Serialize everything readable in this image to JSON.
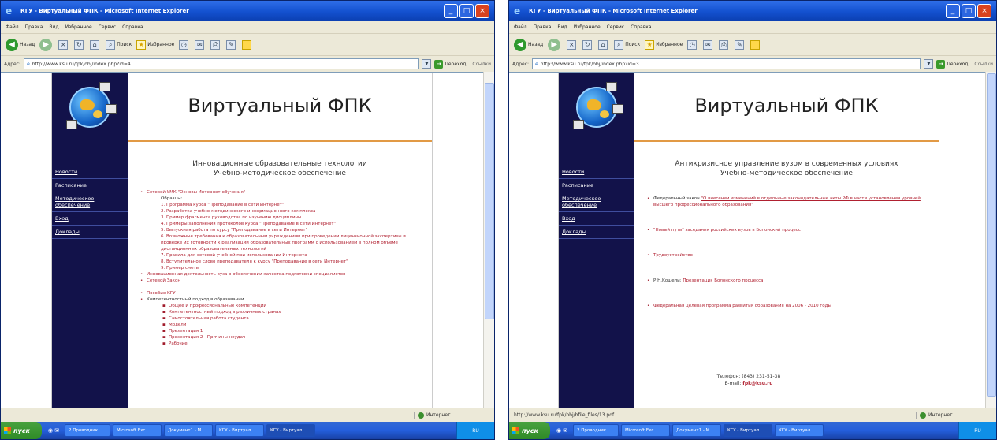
{
  "windows": [
    {
      "title": "КГУ - Виртуальный ФПК - Microsoft Internet Explorer",
      "menu": [
        "Файл",
        "Правка",
        "Вид",
        "Избранное",
        "Сервис",
        "Справка"
      ],
      "toolbar": {
        "back": "Назад",
        "search": "Поиск",
        "favorites": "Избранное"
      },
      "address_label": "Адрес:",
      "address": "http://www.ksu.ru/fpk/obj/index.php?id=4",
      "go_label": "Переход",
      "links_label": "Ссылки",
      "status_left": "",
      "status_right": "Интернет",
      "site": {
        "title": "Виртуальный ФПК",
        "nav": [
          "Новости",
          "Расписание",
          "Методическое обеспечение",
          "Вход",
          "Доклады"
        ],
        "heading": [
          "Инновационные образовательные технологии",
          "Учебно-методическое обеспечение"
        ],
        "items": [
          {
            "level": 1,
            "text": "Сетевой УМК \"Основы Интернет-обучения\"",
            "link": true
          },
          {
            "level": 2,
            "text": "Образцы:"
          },
          {
            "level": 2,
            "text": "1.   Программа курса \"Преподавание в сети Интернет\"",
            "link": true
          },
          {
            "level": 2,
            "text": "2.   Разработка учебно-методического информационного комплекса",
            "link": true
          },
          {
            "level": 2,
            "text": "3.   Пример фрагмента руководства по изучению дисциплины",
            "link": true
          },
          {
            "level": 2,
            "text": "4.   Примеры заполнения протоколов курса \"Преподавание в сети Интернет\"",
            "link": true
          },
          {
            "level": 2,
            "text": "5.   Выпускная работа по курсу \"Преподавание в сети Интернет\"",
            "link": true
          },
          {
            "level": 2,
            "text": "6.   Возможные требования к образовательным учреждениям при проведении лицензионной экспертизы и проверке их готовности к реализации образовательных программ с использованием в полном объеме дистанционных образовательных технологий",
            "link": true
          },
          {
            "level": 2,
            "text": "7.   Правила для сетевой учебной при использовании Интернета",
            "link": true
          },
          {
            "level": 2,
            "text": "8.   Вступительное слово преподавателя к курсу \"Преподавание в сети Интернет\"",
            "link": true
          },
          {
            "level": 2,
            "text": "9.   Пример сметы",
            "link": true
          },
          {
            "level": 1,
            "text": "Инновационная деятельность вуза в обеспечении качества подготовки специалистов",
            "link": true
          },
          {
            "level": 1,
            "text": "Сетевой Закон",
            "link": true
          },
          {
            "level": 0,
            "text": ""
          },
          {
            "level": 1,
            "text": "Пособие КГУ",
            "link": true
          },
          {
            "level": 1,
            "text": "Компетентностный подход в образовании"
          },
          {
            "level": 3,
            "text": "Общее и профессиональные компетенции",
            "link": true
          },
          {
            "level": 3,
            "text": "Компетентностный подход в различных странах",
            "link": true
          },
          {
            "level": 3,
            "text": "Самостоятельная работа студента",
            "link": true
          },
          {
            "level": 3,
            "text": "Модели",
            "link": true
          },
          {
            "level": 3,
            "text": "Презентация 1",
            "link": true
          },
          {
            "level": 3,
            "text": "Презентация 2 - Причины неудач",
            "link": true
          },
          {
            "level": 3,
            "text": "Рабочие",
            "link": true
          }
        ]
      }
    },
    {
      "title": "КГУ - Виртуальный ФПК - Microsoft Internet Explorer",
      "menu": [
        "Файл",
        "Правка",
        "Вид",
        "Избранное",
        "Сервис",
        "Справка"
      ],
      "toolbar": {
        "back": "Назад",
        "search": "Поиск",
        "favorites": "Избранное"
      },
      "address_label": "Адрес:",
      "address": "http://www.ksu.ru/fpk/obj/index.php?id=3",
      "go_label": "Переход",
      "links_label": "Ссылки",
      "status_left": "http://www.ksu.ru/fpk/obj/bfile_files/13.pdf",
      "status_right": "Интернет",
      "site": {
        "title": "Виртуальный ФПК",
        "nav": [
          "Новости",
          "Расписание",
          "Методическое обеспечение",
          "Вход",
          "Доклады"
        ],
        "heading": [
          "Антикризисное управление вузом в современных условиях",
          "Учебно-методическое обеспечение"
        ],
        "items": [
          {
            "pre": "Федеральный закон ",
            "text": "\"О внесении изменений в отдельные законодательные акты РФ в части установления уровней высшего профессионального образования\"",
            "link": true,
            "ul": true
          },
          {
            "pre": "",
            "text": "\"Новый путь\" заседания российских вузов в Болонский процесс",
            "link": true
          },
          {
            "pre": "",
            "text": "Трудоустройство",
            "link": true
          },
          {
            "pre": "Р.Н.Кошели: ",
            "text": "Презентация Болонского процесса",
            "link": true
          },
          {
            "pre": "",
            "text": "Федеральная целевая программа развития образования на 2006 - 2010 годы",
            "link": true
          }
        ],
        "contact_phone": "Телефон: (843) 231-51-38",
        "contact_email_label": "E-mail: ",
        "contact_email": "fpk@ksu.ru"
      }
    }
  ],
  "taskbar": {
    "start": "пуск",
    "buttons": [
      "2 Проводник",
      "Microsoft Exc...",
      "Документ1 - М...",
      "КГУ - Виртуал...",
      "КГУ - Виртуал..."
    ],
    "tray": "RU"
  }
}
